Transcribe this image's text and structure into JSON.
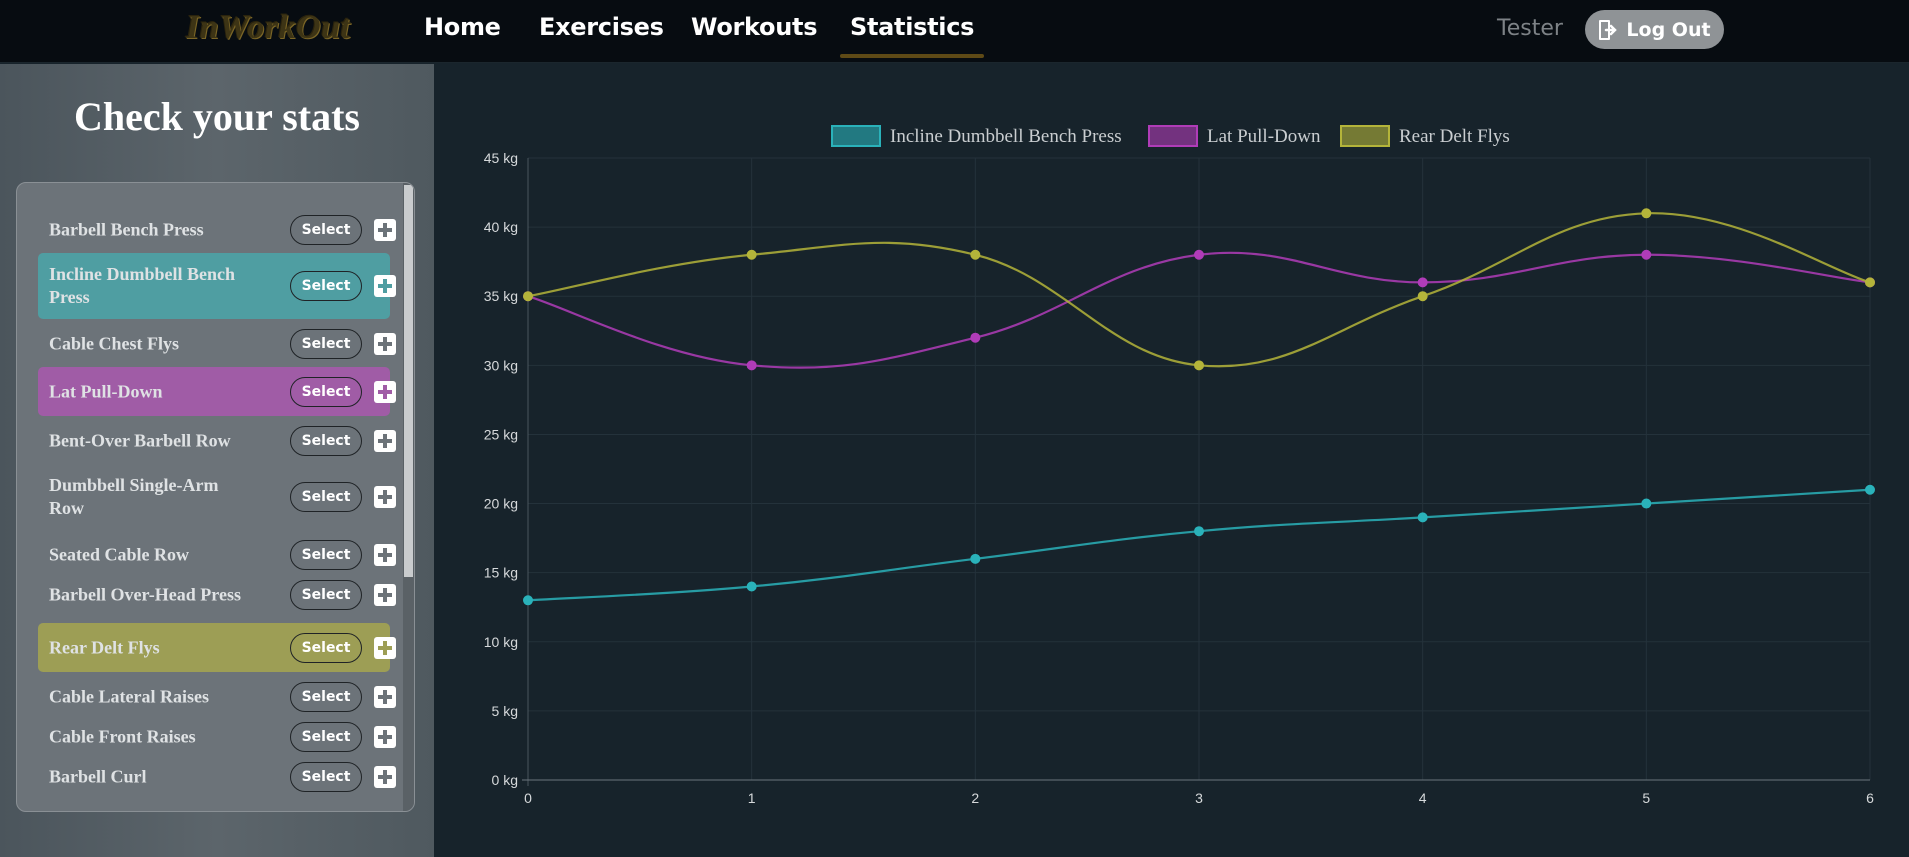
{
  "nav": {
    "brand": "InWorkOut",
    "links": [
      "Home",
      "Exercises",
      "Workouts",
      "Statistics"
    ],
    "active": "Statistics",
    "user": "Tester",
    "logout_label": "Log Out"
  },
  "sidebar": {
    "title": "Check your stats",
    "select_label": "Select",
    "exercises": [
      {
        "label": "Barbell Bench Press",
        "highlight": null
      },
      {
        "label": "Incline Dumbbell Bench Press",
        "highlight": "#4f9ea2"
      },
      {
        "label": "Cable Chest Flys",
        "highlight": null
      },
      {
        "label": "Lat Pull-Down",
        "highlight": "#a05ca6"
      },
      {
        "label": "Bent-Over Barbell Row",
        "highlight": null
      },
      {
        "label": "Dumbbell Single-Arm Row",
        "highlight": null
      },
      {
        "label": "Seated Cable Row",
        "highlight": null
      },
      {
        "label": "Barbell Over-Head Press",
        "highlight": null
      },
      {
        "label": "Rear Delt Flys",
        "highlight": "#9d9e55"
      },
      {
        "label": "Cable Lateral Raises",
        "highlight": null
      },
      {
        "label": "Cable Front Raises",
        "highlight": null
      },
      {
        "label": "Barbell Curl",
        "highlight": null
      }
    ]
  },
  "chart_data": {
    "type": "line",
    "x": [
      0,
      1,
      2,
      3,
      4,
      5,
      6
    ],
    "ylim": [
      0,
      45
    ],
    "yticks": [
      0,
      5,
      10,
      15,
      20,
      25,
      30,
      35,
      40,
      45
    ],
    "ytick_unit": "kg",
    "legend_position": "top-center",
    "grid": true,
    "series": [
      {
        "name": "Incline Dumbbell Bench Press",
        "color": "#2ab2ba",
        "values": [
          13,
          14,
          16,
          18,
          19,
          20,
          21
        ]
      },
      {
        "name": "Lat Pull-Down",
        "color": "#b03cb8",
        "values": [
          35,
          30,
          32,
          38,
          36,
          38,
          36
        ]
      },
      {
        "name": "Rear Delt Flys",
        "color": "#b4b43a",
        "values": [
          35,
          38,
          38,
          30,
          35,
          41,
          36
        ]
      }
    ]
  },
  "colors": {
    "accent": "#5e4a16",
    "background": "#17232b",
    "navbar": "#070c11"
  }
}
